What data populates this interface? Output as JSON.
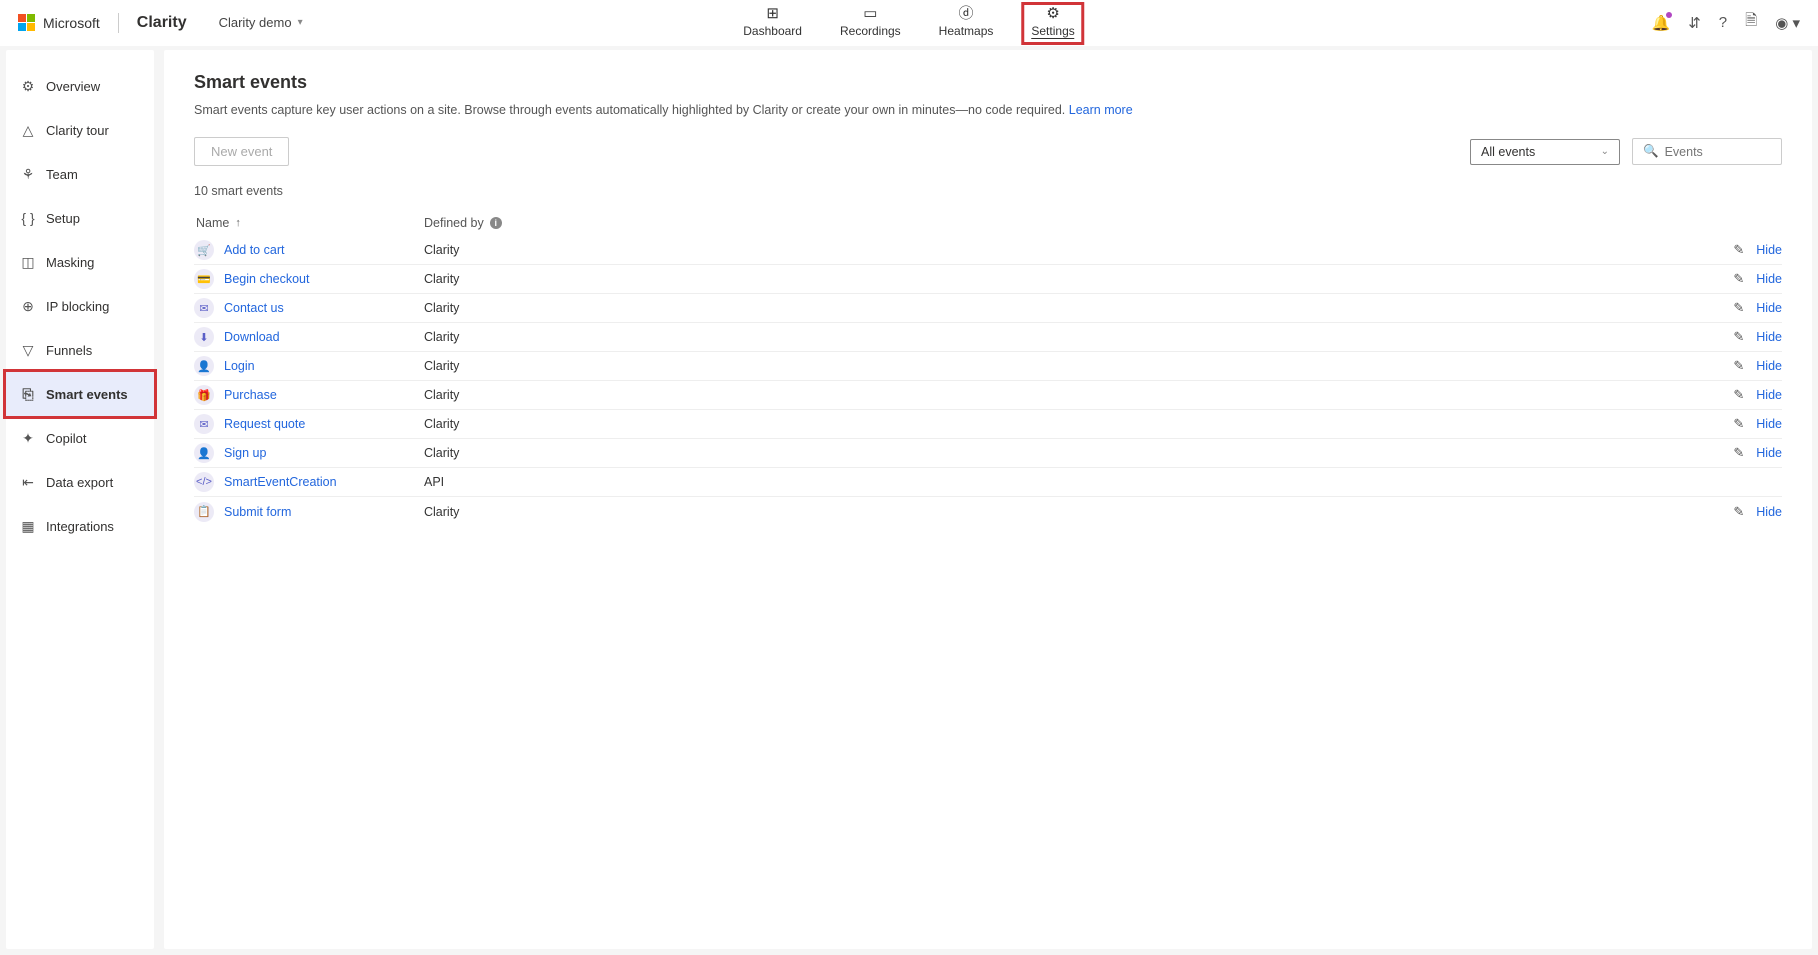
{
  "header": {
    "brand_ms": "Microsoft",
    "brand_product": "Clarity",
    "project_name": "Clarity demo",
    "nav": [
      {
        "label": "Dashboard"
      },
      {
        "label": "Recordings"
      },
      {
        "label": "Heatmaps"
      },
      {
        "label": "Settings"
      }
    ]
  },
  "sidebar": {
    "items": [
      {
        "label": "Overview"
      },
      {
        "label": "Clarity tour"
      },
      {
        "label": "Team"
      },
      {
        "label": "Setup"
      },
      {
        "label": "Masking"
      },
      {
        "label": "IP blocking"
      },
      {
        "label": "Funnels"
      },
      {
        "label": "Smart events"
      },
      {
        "label": "Copilot"
      },
      {
        "label": "Data export"
      },
      {
        "label": "Integrations"
      }
    ]
  },
  "page": {
    "title": "Smart events",
    "desc": "Smart events capture key user actions on a site. Browse through events automatically highlighted by Clarity or create your own in minutes—no code required. ",
    "learn_more": "Learn more",
    "new_event": "New event",
    "filter_label": "All events",
    "search_placeholder": "Events",
    "count_text": "10 smart events",
    "col_name": "Name",
    "col_defined": "Defined by",
    "hide": "Hide"
  },
  "events": [
    {
      "name": "Add to cart",
      "defined_by": "Clarity",
      "can_hide": true
    },
    {
      "name": "Begin checkout",
      "defined_by": "Clarity",
      "can_hide": true
    },
    {
      "name": "Contact us",
      "defined_by": "Clarity",
      "can_hide": true
    },
    {
      "name": "Download",
      "defined_by": "Clarity",
      "can_hide": true
    },
    {
      "name": "Login",
      "defined_by": "Clarity",
      "can_hide": true
    },
    {
      "name": "Purchase",
      "defined_by": "Clarity",
      "can_hide": true
    },
    {
      "name": "Request quote",
      "defined_by": "Clarity",
      "can_hide": true
    },
    {
      "name": "Sign up",
      "defined_by": "Clarity",
      "can_hide": true
    },
    {
      "name": "SmartEventCreation",
      "defined_by": "API",
      "can_hide": false
    },
    {
      "name": "Submit form",
      "defined_by": "Clarity",
      "can_hide": true
    }
  ],
  "event_icons": [
    "🛒",
    "💳",
    "✉",
    "⬇",
    "👤",
    "🎁",
    "✉",
    "👤",
    "</>",
    "📋"
  ]
}
